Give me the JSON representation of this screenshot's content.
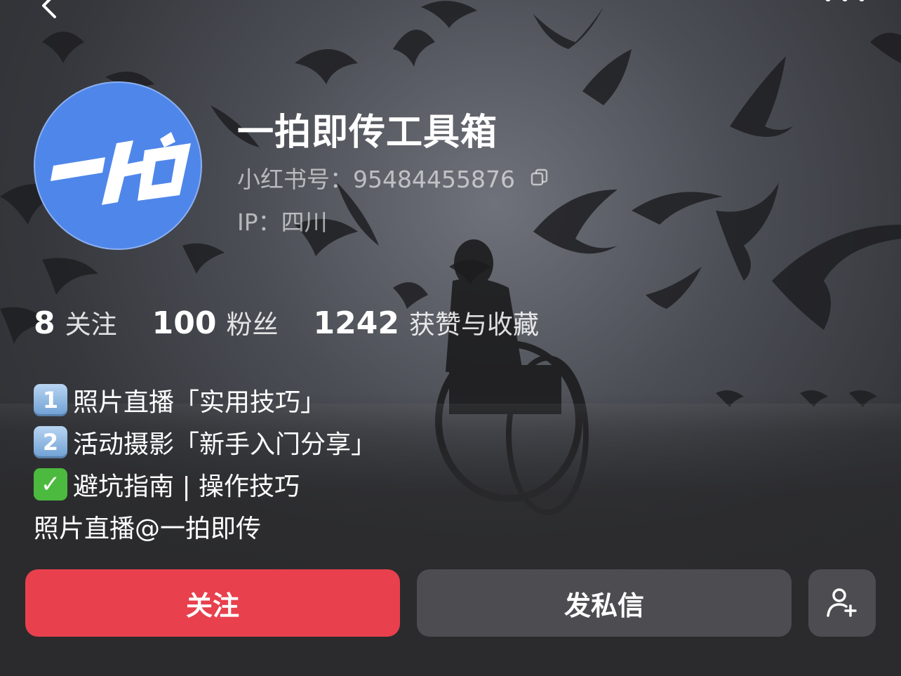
{
  "header": {
    "back_icon": "chevron-left-icon",
    "more_icon": "more-dots-icon"
  },
  "profile": {
    "avatar_text": "一拍",
    "avatar_color": "#4f86ea",
    "name": "一拍即传工具箱",
    "id_label": "小红书号：95484455876",
    "ip_label": "IP：四川"
  },
  "stats": [
    {
      "number": "8",
      "label": "关注"
    },
    {
      "number": "100",
      "label": "粉丝"
    },
    {
      "number": "1242",
      "label": "获赞与收藏"
    }
  ],
  "bio": {
    "line1_badge": "1",
    "line1_text": "照片直播「实用技巧」",
    "line2_badge": "2",
    "line2_text": "活动摄影「新手入门分享」",
    "line3_badge": "✓",
    "line3_text": "避坑指南 | 操作技巧",
    "line4_text": "照片直播@一拍即传"
  },
  "actions": {
    "follow_label": "关注",
    "message_label": "发私信",
    "add_friend_icon": "add-user-icon",
    "accent": "#e8404d"
  }
}
